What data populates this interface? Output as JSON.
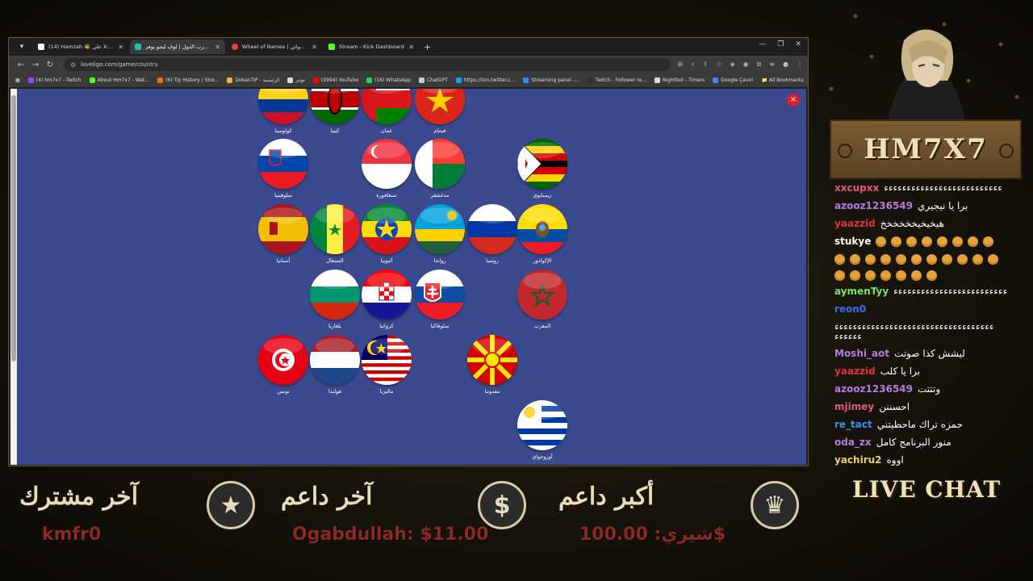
{
  "browser": {
    "tabs": [
      {
        "label": "(14) Hamzah 🐝 علي X: \"الفقاعة",
        "color": "#ffffff",
        "active": false
      },
      {
        "label": "لعبة حرب الدول | لوف ليجو يوفر",
        "color": "#23c1a7",
        "active": true
      },
      {
        "label": "Wheel of Names | العشوائي 🔊",
        "color": "#e0443a",
        "active": false
      },
      {
        "label": "Stream - Kick Dashboard",
        "color": "#53fc18",
        "active": false
      }
    ],
    "url": "loveligo.com/game/country",
    "bookmarks": [
      {
        "label": "(4) hm7x7 - Twitch",
        "color": "#9146ff"
      },
      {
        "label": "About Hm7x7 - Wat...",
        "color": "#53fc18"
      },
      {
        "label": "(6) Tip History / Stre...",
        "color": "#f26b21"
      },
      {
        "label": "DokanTIP - الرئيسية",
        "color": "#f2b134"
      },
      {
        "label": "تويتر",
        "color": "#dddddd"
      },
      {
        "label": "(3994) YouTube",
        "color": "#ff0000"
      },
      {
        "label": "(16) WhatsApp",
        "color": "#25d366"
      },
      {
        "label": "ChatGPT",
        "color": "#cccccc"
      },
      {
        "label": "https://ton.twitter.c...",
        "color": "#1da1f2"
      },
      {
        "label": "Streaming panel -...",
        "color": "#3b82f6"
      },
      {
        "label": "Twitch - Follower re...",
        "color": "#333333"
      },
      {
        "label": "Nightbot - Timers",
        "color": "#dddddd"
      },
      {
        "label": "Google Çeviri",
        "color": "#4285f4"
      }
    ],
    "all_bookmarks": "All Bookmarks"
  },
  "flags": [
    {
      "id": "colombia",
      "name": "كولومبيا"
    },
    {
      "id": "kenya",
      "name": "كينيا"
    },
    {
      "id": "oman",
      "name": "عمان"
    },
    {
      "id": "vietnam",
      "name": "فيتنام"
    },
    {
      "id": "slovenia",
      "name": "سلوفينيا"
    },
    {
      "id": "singapore",
      "name": "سنغافورة"
    },
    {
      "id": "madagascar",
      "name": "مدغشقر"
    },
    {
      "id": "zimbabwe",
      "name": "زيمبابوي"
    },
    {
      "id": "spain",
      "name": "أسبانيا"
    },
    {
      "id": "senegal",
      "name": "السنغال"
    },
    {
      "id": "ethiopia",
      "name": "أثيوبيا"
    },
    {
      "id": "rwanda",
      "name": "رواندا"
    },
    {
      "id": "russia",
      "name": "روسيا"
    },
    {
      "id": "ecuador",
      "name": "الإكوادور"
    },
    {
      "id": "bulgaria",
      "name": "بلغاريا"
    },
    {
      "id": "croatia",
      "name": "كرواتيا"
    },
    {
      "id": "slovakia",
      "name": "سلوفاكيا"
    },
    {
      "id": "morocco",
      "name": "المغرب"
    },
    {
      "id": "tunisia",
      "name": "تونس"
    },
    {
      "id": "netherlands",
      "name": "هولندا"
    },
    {
      "id": "malaysia",
      "name": "ماليزيا"
    },
    {
      "id": "macedonia",
      "name": "مقدونيا"
    },
    {
      "id": "uruguay",
      "name": "أوروجواي"
    }
  ],
  "close_label": "×",
  "logo_text": "HM7X7",
  "chat": [
    {
      "user": "xxcupxx",
      "color": "#e05a7a",
      "msg": "ءءءءءءءءءءءءءءءءءءءءءءءءءء"
    },
    {
      "user": "azooz1236549",
      "color": "#b77be0",
      "msg": "برا يا نيجيري"
    },
    {
      "user": "yaazzid",
      "color": "#e0313d",
      "msg": "هيخيخيخخخخخخ"
    },
    {
      "user": "stukye",
      "color": "#ffffff",
      "msg": ""
    },
    {
      "user": "aymenTyy",
      "color": "#7ce25a",
      "msg": "ءءءءءءءءءءءءءءءءءءءءءءءءء"
    },
    {
      "user": "reon0",
      "color": "#3c6ff0",
      "msg": ""
    },
    {
      "user": "",
      "color": "#ffffff",
      "msg": "ءءءءءءءءءءءءءءءءءءءءءءءءءءءءءءءءءءء"
    },
    {
      "user": "",
      "color": "#ffffff",
      "msg": "ءءءءءء"
    },
    {
      "user": "Moshi_aot",
      "color": "#b77be0",
      "msg": "ليشش كذا صوتت"
    },
    {
      "user": "yaazzid",
      "color": "#e0313d",
      "msg": "برا يا كلب"
    },
    {
      "user": "azooz1236549",
      "color": "#b77be0",
      "msg": "وتتتت"
    },
    {
      "user": "mjimey",
      "color": "#e05a7a",
      "msg": "احسننن"
    },
    {
      "user": "re_tact",
      "color": "#3c8ff0",
      "msg": "حمزه تراك ماحطيتني"
    },
    {
      "user": "oda_zx",
      "color": "#b77be0",
      "msg": "منور البرنامج كامل"
    },
    {
      "user": "yachiru2",
      "color": "#f0d060",
      "msg": "اووه"
    }
  ],
  "live_chat": "LIVE CHAT",
  "bottom": {
    "last_sub_title": "آخر مشترك",
    "last_sub_value": "kmfr0",
    "last_donor_title": "آخر داعم",
    "last_donor_value": "Ogabdullah: $11.00",
    "top_donor_title": "أكبر داعم",
    "top_donor_value": "شيري: 100.00$",
    "star_icon": "★",
    "dollar_icon": "$",
    "crown_icon": "♛"
  }
}
